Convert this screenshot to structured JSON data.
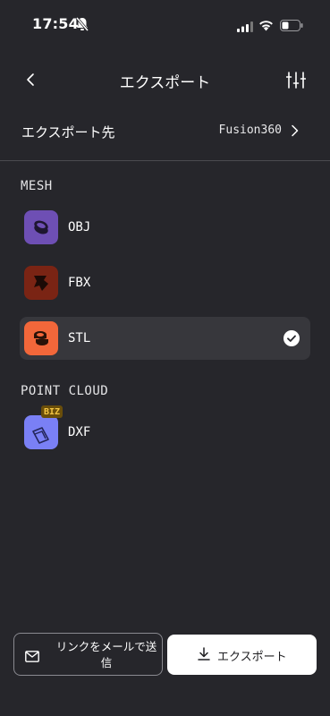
{
  "status_bar": {
    "time": "17:54"
  },
  "header": {
    "title": "エクスポート"
  },
  "destination": {
    "label": "エクスポート先",
    "value": "Fusion360"
  },
  "sections": {
    "mesh_title": "MESH",
    "point_cloud_title": "POINT CLOUD"
  },
  "formats": {
    "obj": {
      "label": "OBJ",
      "color": "#6e4fb4"
    },
    "fbx": {
      "label": "FBX",
      "color": "#7a2414"
    },
    "stl": {
      "label": "STL",
      "color": "#f2673a",
      "selected": true
    },
    "dxf": {
      "label": "DXF",
      "color": "#7a80f5",
      "badge": "BIZ"
    }
  },
  "actions": {
    "mail_label": "リンクをメールで送信",
    "export_label": "エクスポート"
  }
}
